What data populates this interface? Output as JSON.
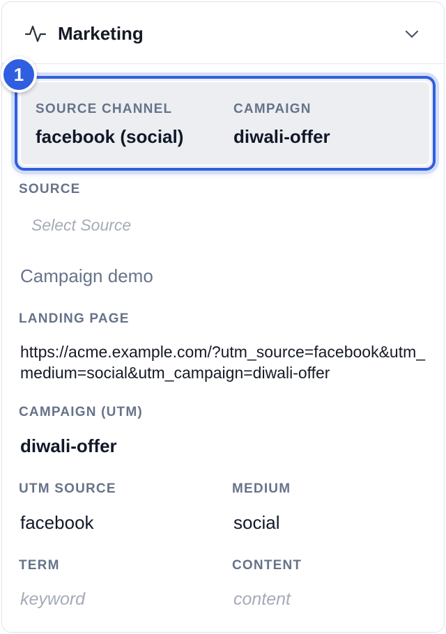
{
  "header": {
    "title": "Marketing",
    "icon": "activity-pulse-icon",
    "toggle_icon": "chevron-down-icon"
  },
  "highlight": {
    "badge": "1",
    "accent_color": "#2f5fe0",
    "source_channel": {
      "label": "SOURCE CHANNEL",
      "value": "facebook (social)"
    },
    "campaign": {
      "label": "CAMPAIGN",
      "value": "diwali-offer"
    }
  },
  "source": {
    "label": "SOURCE",
    "placeholder": "Select Source"
  },
  "campaign_name": "Campaign demo",
  "landing_page": {
    "label": "LANDING PAGE",
    "value": "https://acme.example.com/?utm_source=facebook&utm_medium=social&utm_campaign=diwali-offer"
  },
  "campaign_utm": {
    "label": "CAMPAIGN (UTM)",
    "value": "diwali-offer"
  },
  "utm_source": {
    "label": "UTM SOURCE",
    "value": "facebook"
  },
  "medium": {
    "label": "MEDIUM",
    "value": "social"
  },
  "term": {
    "label": "TERM",
    "placeholder": "keyword"
  },
  "content": {
    "label": "CONTENT",
    "placeholder": "content"
  }
}
